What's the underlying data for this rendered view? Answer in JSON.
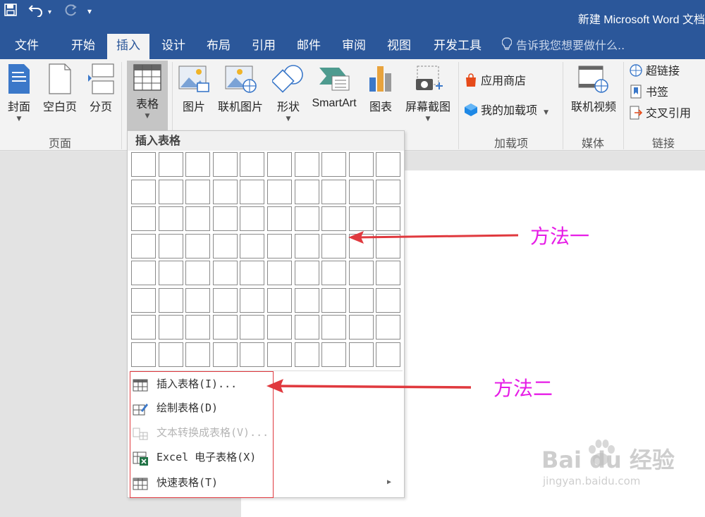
{
  "window": {
    "title": "新建 Microsoft Word 文档"
  },
  "qat": {
    "customize_glyph": "▾"
  },
  "tabs": [
    {
      "label": "文件"
    },
    {
      "label": "开始"
    },
    {
      "label": "插入"
    },
    {
      "label": "设计"
    },
    {
      "label": "布局"
    },
    {
      "label": "引用"
    },
    {
      "label": "邮件"
    },
    {
      "label": "审阅"
    },
    {
      "label": "视图"
    },
    {
      "label": "开发工具"
    }
  ],
  "active_tab": "插入",
  "tell_me": "告诉我您想要做什么..",
  "ribbon": {
    "pages": {
      "cover": "封面",
      "blank": "空白页",
      "break": "分页",
      "group": "页面"
    },
    "table": {
      "label": "表格"
    },
    "illustrations": {
      "picture": "图片",
      "online_picture": "联机图片",
      "shapes": "形状",
      "smartart": "SmartArt",
      "chart": "图表",
      "screenshot": "屏幕截图"
    },
    "addins": {
      "store": "应用商店",
      "my_addins": "我的加载项",
      "group": "加载项"
    },
    "media": {
      "online_video": "联机视频",
      "group": "媒体"
    },
    "links": {
      "hyperlink": "超链接",
      "bookmark": "书签",
      "cross_ref": "交叉引用",
      "group": "链接"
    }
  },
  "dropdown": {
    "header": "插入表格",
    "grid": {
      "columns": 10,
      "rows": 8
    },
    "items": [
      {
        "label": "插入表格(I)...",
        "icon": "insert-table-icon",
        "enabled": true
      },
      {
        "label": "绘制表格(D)",
        "icon": "draw-table-icon",
        "enabled": true
      },
      {
        "label": "文本转换成表格(V)...",
        "icon": "text-to-table-icon",
        "enabled": false
      },
      {
        "label": "Excel 电子表格(X)",
        "icon": "excel-icon",
        "enabled": true
      },
      {
        "label": "快速表格(T)",
        "icon": "quick-tables-icon",
        "enabled": true
      }
    ]
  },
  "annotations": {
    "method1": "方法一",
    "method2": "方法二"
  },
  "watermark": {
    "brand": "Bai du 经验",
    "url": "jingyan.baidu.com"
  },
  "colors": {
    "title_bar": "#2b579a",
    "ribbon": "#f3f3f3",
    "annotation": "#e61ce6",
    "arrow": "#e0393e"
  }
}
